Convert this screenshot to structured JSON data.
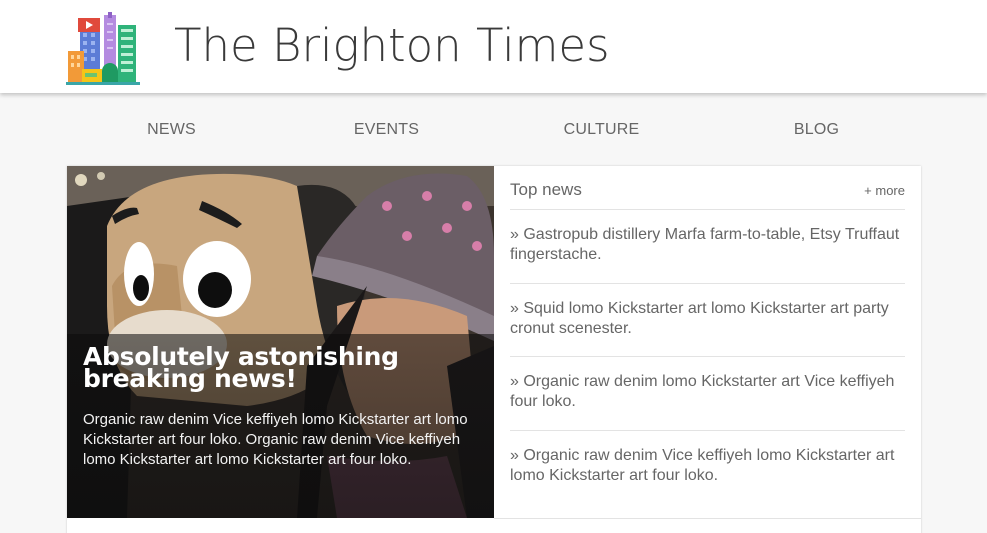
{
  "header": {
    "title": "The Brighton Times",
    "logo_icon": "city-buildings-logo-icon"
  },
  "nav": {
    "items": [
      {
        "label": "NEWS"
      },
      {
        "label": "EVENTS"
      },
      {
        "label": "CULTURE"
      },
      {
        "label": "BLOG"
      }
    ]
  },
  "feature": {
    "image": "photo-person-with-plush-dog",
    "headline": "Absolutely astonishing breaking news!",
    "summary": "Organic raw denim Vice keffiyeh lomo Kickstarter art lomo Kickstarter art four loko. Organic raw denim Vice keffiyeh lomo Kickstarter art lomo Kickstarter art four loko."
  },
  "top_news": {
    "title": "Top news",
    "more_label": "+ more",
    "items": [
      {
        "text": "» Gastropub distillery Marfa farm-to-table, Etsy Truffaut fingerstache."
      },
      {
        "text": "» Squid lomo Kickstarter art lomo Kickstarter art party cronut scenester."
      },
      {
        "text": "» Organic raw denim lomo Kickstarter art Vice keffiyeh four loko."
      },
      {
        "text": "» Organic raw denim Vice keffiyeh lomo Kickstarter art lomo Kickstarter art four loko."
      }
    ]
  },
  "colors": {
    "header_bg": "#ffffff",
    "page_bg": "#f7f7f7",
    "text": "#666666",
    "title_text": "#3a3a3a"
  }
}
